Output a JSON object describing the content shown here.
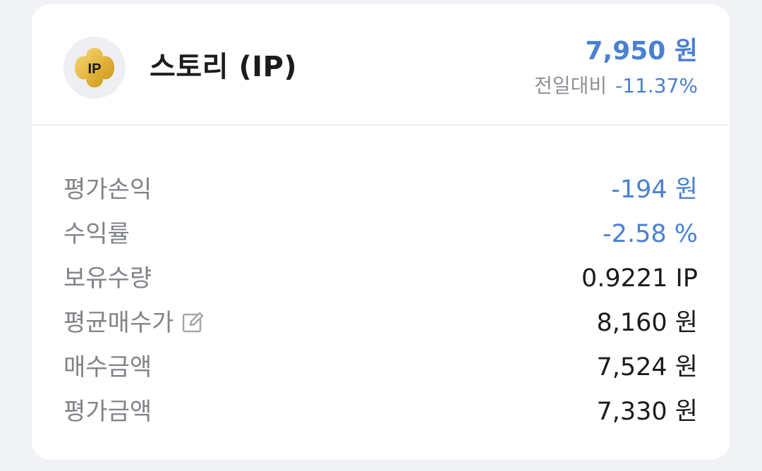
{
  "coin": {
    "icon_text": "IP",
    "name": "스토리 (IP)",
    "price": "7,950 원",
    "change_label": "전일대비",
    "change_value": "-11.37%"
  },
  "rows": [
    {
      "label": "평가손익",
      "value": "-194 원",
      "color": "#4a80d2"
    },
    {
      "label": "수익률",
      "value": "-2.58 %",
      "color": "#4a80d2"
    },
    {
      "label": "보유수량",
      "value": "0.9221 IP",
      "color": "#1c1c1e"
    },
    {
      "label": "평균매수가",
      "value": "8,160 원",
      "color": "#1c1c1e",
      "icon": "edit-icon"
    },
    {
      "label": "매수금액",
      "value": "7,524 원",
      "color": "#1c1c1e"
    },
    {
      "label": "평가금액",
      "value": "7,330 원",
      "color": "#1c1c1e"
    }
  ],
  "colors": {
    "accent": "#4a80d2",
    "coin_gold": "#e8b840"
  }
}
